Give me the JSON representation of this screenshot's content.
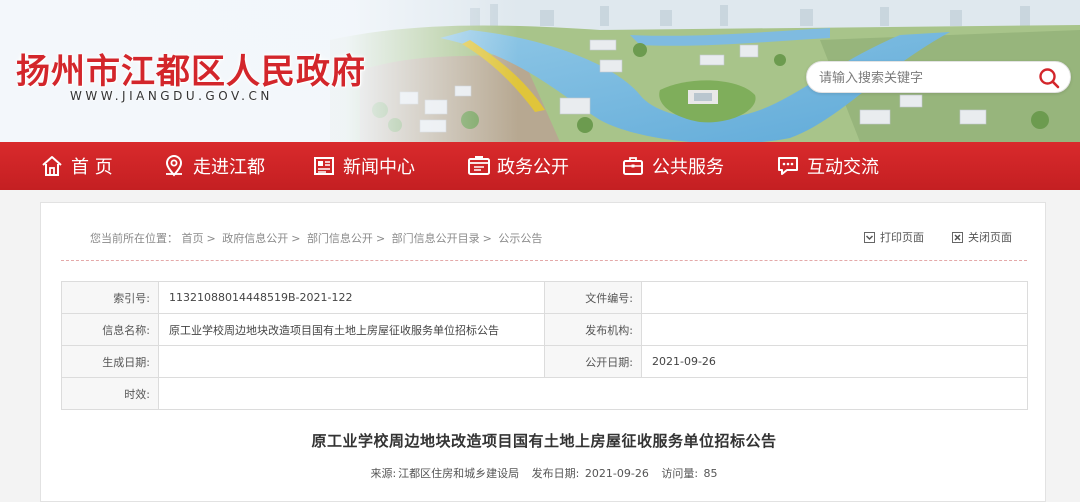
{
  "site": {
    "title": "扬州市江都区人民政府",
    "domain": "WWW.JIANGDU.GOV.CN"
  },
  "search": {
    "placeholder": "请输入搜索关键字",
    "icon": "search-icon"
  },
  "nav": {
    "items": [
      {
        "label": "首 页",
        "icon": "home-icon"
      },
      {
        "label": "走进江都",
        "icon": "location-icon"
      },
      {
        "label": "新闻中心",
        "icon": "newspaper-icon"
      },
      {
        "label": "政务公开",
        "icon": "gov-affairs-icon"
      },
      {
        "label": "公共服务",
        "icon": "briefcase-icon"
      },
      {
        "label": "互动交流",
        "icon": "chat-icon"
      }
    ]
  },
  "breadcrumb": {
    "prefix": "您当前所在位置：",
    "items": [
      "首页",
      "政府信息公开",
      "部门信息公开",
      "部门信息公开目录",
      "公示公告"
    ],
    "separator": ">"
  },
  "actions": {
    "print": "打印页面",
    "close": "关闭页面"
  },
  "meta": {
    "index_label": "索引号:",
    "index_value": "11321088014448519B-2021-122",
    "docno_label": "文件编号:",
    "docno_value": "",
    "info_label": "信息名称:",
    "info_value": "原工业学校周边地块改造项目国有土地上房屋征收服务单位招标公告",
    "agency_label": "发布机构:",
    "agency_value": "",
    "gen_date_label": "生成日期:",
    "gen_date_value": "",
    "pub_date_label": "公开日期:",
    "pub_date_value": "2021-09-26",
    "validity_label": "时效:",
    "validity_value": ""
  },
  "article": {
    "title": "原工业学校周边地块改造项目国有土地上房屋征收服务单位招标公告",
    "source_label": "来源:",
    "source_value": "江都区住房和城乡建设局",
    "date_label": "发布日期:",
    "date_value": "2021-09-26",
    "views_label": "访问量:",
    "views_value": "85"
  },
  "colors": {
    "brand_red": "#d3262b",
    "nav_red": "#c8222a"
  }
}
